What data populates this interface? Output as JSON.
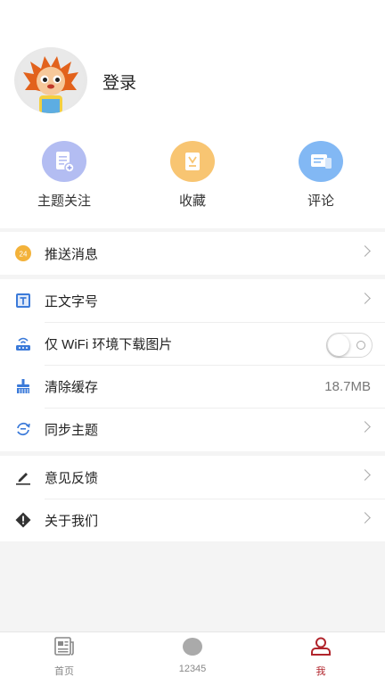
{
  "profile": {
    "login_label": "登录",
    "avatar_icon": "cartoon-lion-avatar"
  },
  "quick_actions": [
    {
      "label": "主题关注",
      "icon": "topic-follow-icon",
      "color": "#a8b4f0"
    },
    {
      "label": "收藏",
      "icon": "favorite-icon",
      "color": "#f7c16b"
    },
    {
      "label": "评论",
      "icon": "comment-icon",
      "color": "#7cb2f2"
    }
  ],
  "menu": {
    "push": {
      "label": "推送消息",
      "icon": "push-badge-icon"
    },
    "font_size": {
      "label": "正文字号",
      "icon": "text-size-icon"
    },
    "wifi_images": {
      "label": "仅 WiFi 环境下载图片",
      "icon": "wifi-router-icon",
      "enabled": false
    },
    "clear_cache": {
      "label": "清除缓存",
      "icon": "broom-icon",
      "value": "18.7MB"
    },
    "sync_theme": {
      "label": "同步主题",
      "icon": "sync-icon"
    },
    "feedback": {
      "label": "意见反馈",
      "icon": "pen-icon"
    },
    "about": {
      "label": "关于我们",
      "icon": "info-diamond-icon"
    }
  },
  "tabbar": [
    {
      "label": "首页",
      "icon": "newspaper-icon",
      "active": false
    },
    {
      "label": "12345",
      "icon": "hotline-icon",
      "active": false
    },
    {
      "label": "我",
      "icon": "user-icon",
      "active": true
    }
  ],
  "colors": {
    "accent": "#b1252c",
    "background": "#f4f4f4"
  }
}
